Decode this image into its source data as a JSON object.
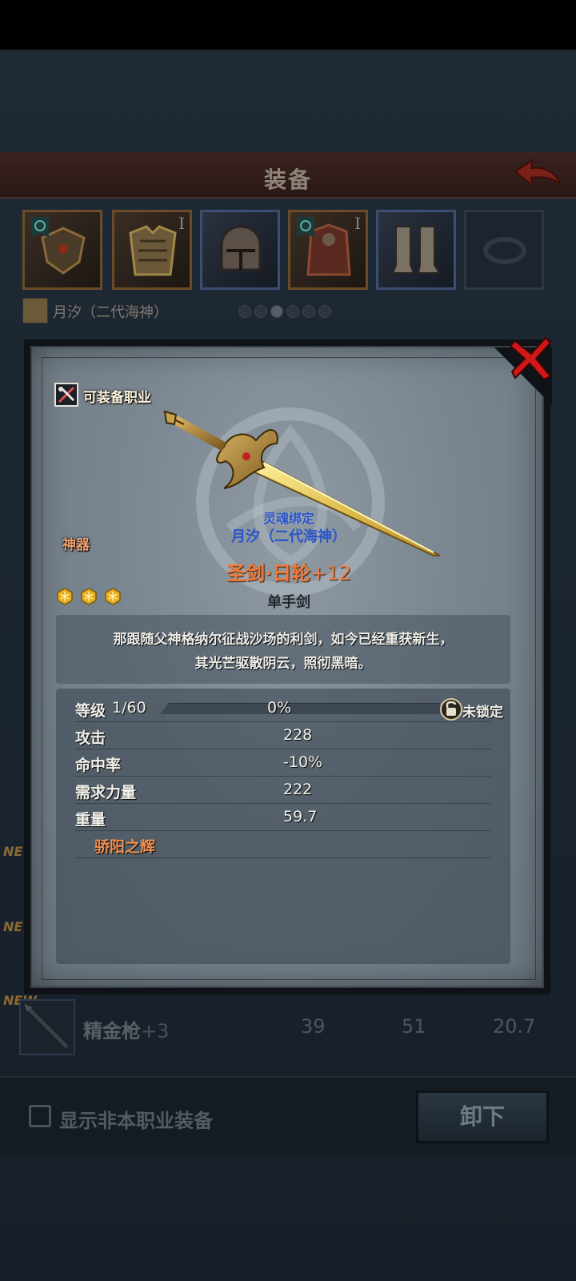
{
  "screen": {
    "title": "装备",
    "character_name": "月汐（二代海神）",
    "page_count": 6,
    "active_page": 3,
    "equipment_slots": [
      {
        "icon": "pauldron-icon",
        "tier": "",
        "frame": "gold",
        "has_element": true
      },
      {
        "icon": "chest-armor-icon",
        "tier": "I",
        "frame": "gold",
        "has_element": false
      },
      {
        "icon": "helmet-icon",
        "tier": "",
        "frame": "blue",
        "has_element": false
      },
      {
        "icon": "cloak-armor-icon",
        "tier": "I",
        "frame": "gold",
        "has_element": true
      },
      {
        "icon": "boots-icon",
        "tier": "",
        "frame": "blue",
        "has_element": false
      },
      {
        "icon": "ring-slot-icon",
        "tier": "",
        "frame": "empty",
        "has_element": false
      }
    ],
    "list_item": {
      "new_tag": "NEW",
      "name": "精金枪",
      "plus": "+3",
      "stats": [
        "39",
        "51",
        "20.7"
      ]
    },
    "new_tags": [
      "NE",
      "NE",
      "NEW"
    ],
    "show_other_class_label": "显示非本职业装备",
    "unequip_label": "卸下"
  },
  "item_detail": {
    "class_label": "可装备职业",
    "rarity": "神器",
    "soul_bound": "灵魂绑定",
    "owner": "月汐（二代海神）",
    "name": "圣剑·日轮",
    "enhance": "+12",
    "star_count": 3,
    "type": "单手剑",
    "description": [
      "那跟随父神格纳尔征战沙场的利剑，如今已经重获新生，",
      "其光芒驱散阴云，照彻黑暗。"
    ],
    "level_label": "等级",
    "level_value": "1/60",
    "xp_percent": 0,
    "xp_text": "0%",
    "lock_label": "未锁定",
    "stats": [
      {
        "label": "攻击",
        "value": "228"
      },
      {
        "label": "命中率",
        "value": "-10%"
      },
      {
        "label": "需求力量",
        "value": "222"
      },
      {
        "label": "重量",
        "value": "59.7"
      }
    ],
    "skill": "骄阳之辉"
  },
  "colors": {
    "rarity": "#f0a070",
    "bound": "#2a55c8",
    "item_name": "#f07a3a",
    "skill": "#f09050",
    "close": "#d01818"
  }
}
